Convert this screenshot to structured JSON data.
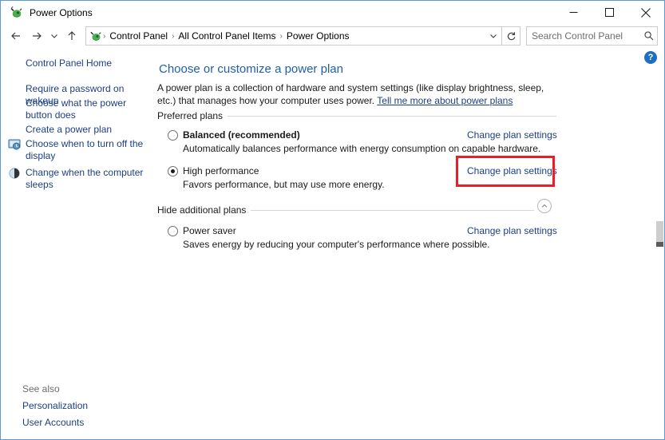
{
  "window": {
    "title": "Power Options",
    "icon": "power-plug-icon",
    "controls": {
      "minimize": "minimize-icon",
      "maximize": "maximize-icon",
      "close": "close-icon"
    }
  },
  "addressbar": {
    "back": "back-arrow-icon",
    "forward": "forward-arrow-icon",
    "recent": "chevron-down-icon",
    "up": "up-arrow-icon",
    "crumb_icon": "power-plug-icon",
    "breadcrumbs": [
      "Control Panel",
      "All Control Panel Items",
      "Power Options"
    ],
    "separator": "›",
    "dropdown": "chevron-down-icon",
    "refresh": "refresh-icon",
    "search": {
      "placeholder": "Search Control Panel",
      "value": "",
      "icon": "search-icon"
    }
  },
  "help": {
    "label": "?",
    "icon": "help-icon"
  },
  "sidebar": {
    "home_label": "Control Panel Home",
    "items": [
      {
        "label": "Require a password on wakeup",
        "icon": null
      },
      {
        "label": "Choose what the power button does",
        "icon": null
      },
      {
        "label": "Create a power plan",
        "icon": null
      },
      {
        "label": "Choose when to turn off the display",
        "icon": "display-shield-icon"
      },
      {
        "label": "Change when the computer sleeps",
        "icon": "sleep-shield-icon"
      }
    ],
    "see_also_label": "See also",
    "see_also": [
      "Personalization",
      "User Accounts"
    ]
  },
  "main": {
    "heading": "Choose or customize a power plan",
    "description": "A power plan is a collection of hardware and system settings (like display brightness, sleep, etc.) that manages how your computer uses power.",
    "description_link": "Tell me more about power plans",
    "preferred_plans_label": "Preferred plans",
    "hide_additional_label": "Hide additional plans",
    "collapse_icon": "chevron-up-icon",
    "change_link_label": "Change plan settings",
    "preferred_plans": [
      {
        "name": "Balanced (recommended)",
        "description": "Automatically balances performance with energy consumption on capable hardware.",
        "selected": false,
        "bold": true
      },
      {
        "name": "High performance",
        "description": "Favors performance, but may use more energy.",
        "selected": true,
        "bold": false
      }
    ],
    "additional_plans": [
      {
        "name": "Power saver",
        "description": "Saves energy by reducing your computer's performance where possible.",
        "selected": false,
        "bold": false
      }
    ]
  },
  "colors": {
    "window_border": "#5b9bd5",
    "link": "#1b3f84",
    "heading": "#1f5fa9",
    "highlight": "#ee1c25",
    "help_badge": "#1e6fc4"
  }
}
